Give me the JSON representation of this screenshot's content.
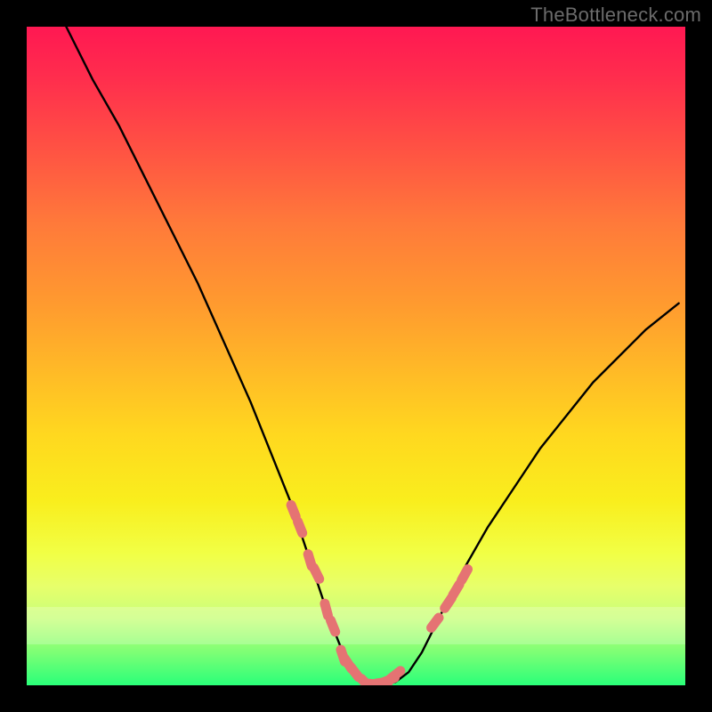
{
  "watermark": "TheBottleneck.com",
  "chart_data": {
    "type": "line",
    "title": "",
    "xlabel": "",
    "ylabel": "",
    "xlim": [
      0,
      100
    ],
    "ylim": [
      0,
      100
    ],
    "grid": false,
    "legend": false,
    "series": [
      {
        "name": "curve",
        "stroke": "#000000",
        "x": [
          6,
          10,
          14,
          18,
          22,
          26,
          30,
          34,
          38,
          40,
          42,
          44,
          46,
          48,
          50,
          52,
          54,
          56,
          58,
          60,
          62,
          66,
          70,
          74,
          78,
          82,
          86,
          90,
          94,
          99
        ],
        "y": [
          100,
          92,
          85,
          77,
          69,
          61,
          52,
          43,
          33,
          28,
          22,
          16,
          10,
          5,
          2,
          0.4,
          0.1,
          0.5,
          2,
          5,
          9,
          17,
          24,
          30,
          36,
          41,
          46,
          50,
          54,
          58
        ]
      },
      {
        "name": "markers",
        "stroke": "#e57373",
        "marker": "round",
        "x": [
          40.5,
          41.5,
          43,
          44,
          45.5,
          46.5,
          48,
          48.8,
          49.8,
          51.5,
          52.5,
          54,
          55,
          56,
          62,
          64,
          65.2,
          66.5
        ],
        "y": [
          26.5,
          24,
          19,
          17,
          11.5,
          9,
          4.5,
          3.3,
          2,
          0.3,
          0.2,
          0.4,
          0.8,
          1.6,
          9.5,
          12.5,
          14.5,
          16.8
        ]
      }
    ],
    "background_gradient": {
      "stops": [
        {
          "pos": 0,
          "color": "#ff1852"
        },
        {
          "pos": 20,
          "color": "#ff5742"
        },
        {
          "pos": 42,
          "color": "#ff9a2f"
        },
        {
          "pos": 62,
          "color": "#ffd81f"
        },
        {
          "pos": 80,
          "color": "#f1ff45"
        },
        {
          "pos": 95,
          "color": "#7dff75"
        },
        {
          "pos": 100,
          "color": "#2aff79"
        }
      ]
    }
  }
}
